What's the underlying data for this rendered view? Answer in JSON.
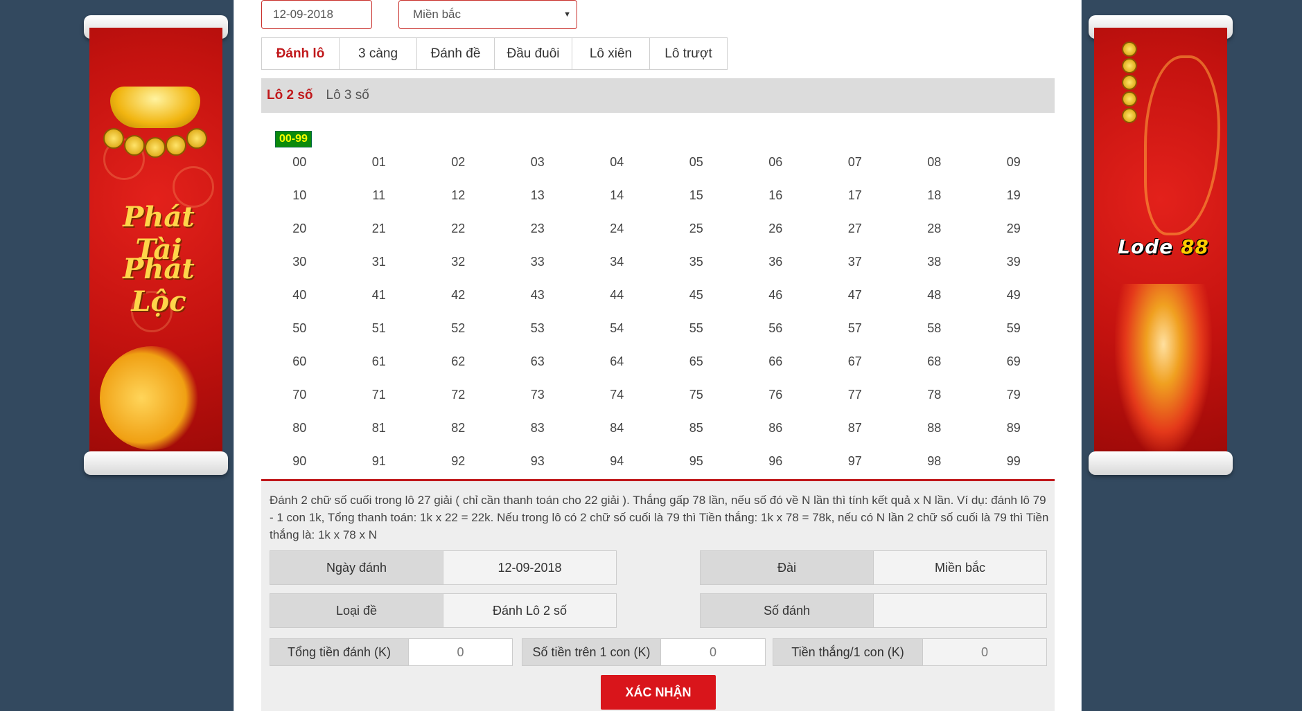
{
  "banners": {
    "left_text_1": "Phát Tài",
    "left_text_2": "Phát Lộc",
    "right_logo_word": "Lode",
    "right_logo_num": "88"
  },
  "filters": {
    "date": "12-09-2018",
    "region": "Miền bắc"
  },
  "tabs": [
    "Đánh lô",
    "3 càng",
    "Đánh đề",
    "Đầu đuôi",
    "Lô xiên",
    "Lô trượt"
  ],
  "active_tab": "Đánh lô",
  "subtabs": [
    "Lô 2 số",
    "Lô 3 số"
  ],
  "active_subtab": "Lô 2 số",
  "range_badge": "00-99",
  "numbers": [
    [
      "00",
      "01",
      "02",
      "03",
      "04",
      "05",
      "06",
      "07",
      "08",
      "09"
    ],
    [
      "10",
      "11",
      "12",
      "13",
      "14",
      "15",
      "16",
      "17",
      "18",
      "19"
    ],
    [
      "20",
      "21",
      "22",
      "23",
      "24",
      "25",
      "26",
      "27",
      "28",
      "29"
    ],
    [
      "30",
      "31",
      "32",
      "33",
      "34",
      "35",
      "36",
      "37",
      "38",
      "39"
    ],
    [
      "40",
      "41",
      "42",
      "43",
      "44",
      "45",
      "46",
      "47",
      "48",
      "49"
    ],
    [
      "50",
      "51",
      "52",
      "53",
      "54",
      "55",
      "56",
      "57",
      "58",
      "59"
    ],
    [
      "60",
      "61",
      "62",
      "63",
      "64",
      "65",
      "66",
      "67",
      "68",
      "69"
    ],
    [
      "70",
      "71",
      "72",
      "73",
      "74",
      "75",
      "76",
      "77",
      "78",
      "79"
    ],
    [
      "80",
      "81",
      "82",
      "83",
      "84",
      "85",
      "86",
      "87",
      "88",
      "89"
    ],
    [
      "90",
      "91",
      "92",
      "93",
      "94",
      "95",
      "96",
      "97",
      "98",
      "99"
    ]
  ],
  "description": "Đánh 2 chữ số cuối trong lô 27 giải ( chỉ cần thanh toán cho 22 giải ). Thắng gấp 78 lần, nếu số đó về N lần thì tính kết quả x N lần. Ví dụ: đánh lô 79 - 1 con 1k, Tổng thanh toán: 1k x 22 = 22k. Nếu trong lô có 2 chữ số cuối là 79 thì Tiền thắng: 1k x 78 = 78k, nếu có N lần 2 chữ số cuối là 79 thì Tiền thắng là: 1k x 78 x N",
  "summary": {
    "date_label": "Ngày đánh",
    "date_value": "12-09-2018",
    "station_label": "Đài",
    "station_value": "Miền bắc",
    "type_label": "Loại đề",
    "type_value": "Đánh Lô 2 số",
    "numbers_label": "Số đánh",
    "numbers_value": ""
  },
  "totals": {
    "total_label": "Tổng tiền đánh (K)",
    "total_value": "0",
    "per_label": "Số tiền trên 1 con (K)",
    "per_value": "0",
    "win_label": "Tiền thắng/1 con (K)",
    "win_value": "0"
  },
  "confirm_label": "XÁC NHẬN",
  "colors": {
    "accent": "#c0181b",
    "background": "#33495f",
    "badge_bg": "#0b8a0b",
    "badge_text": "#ffff00"
  }
}
